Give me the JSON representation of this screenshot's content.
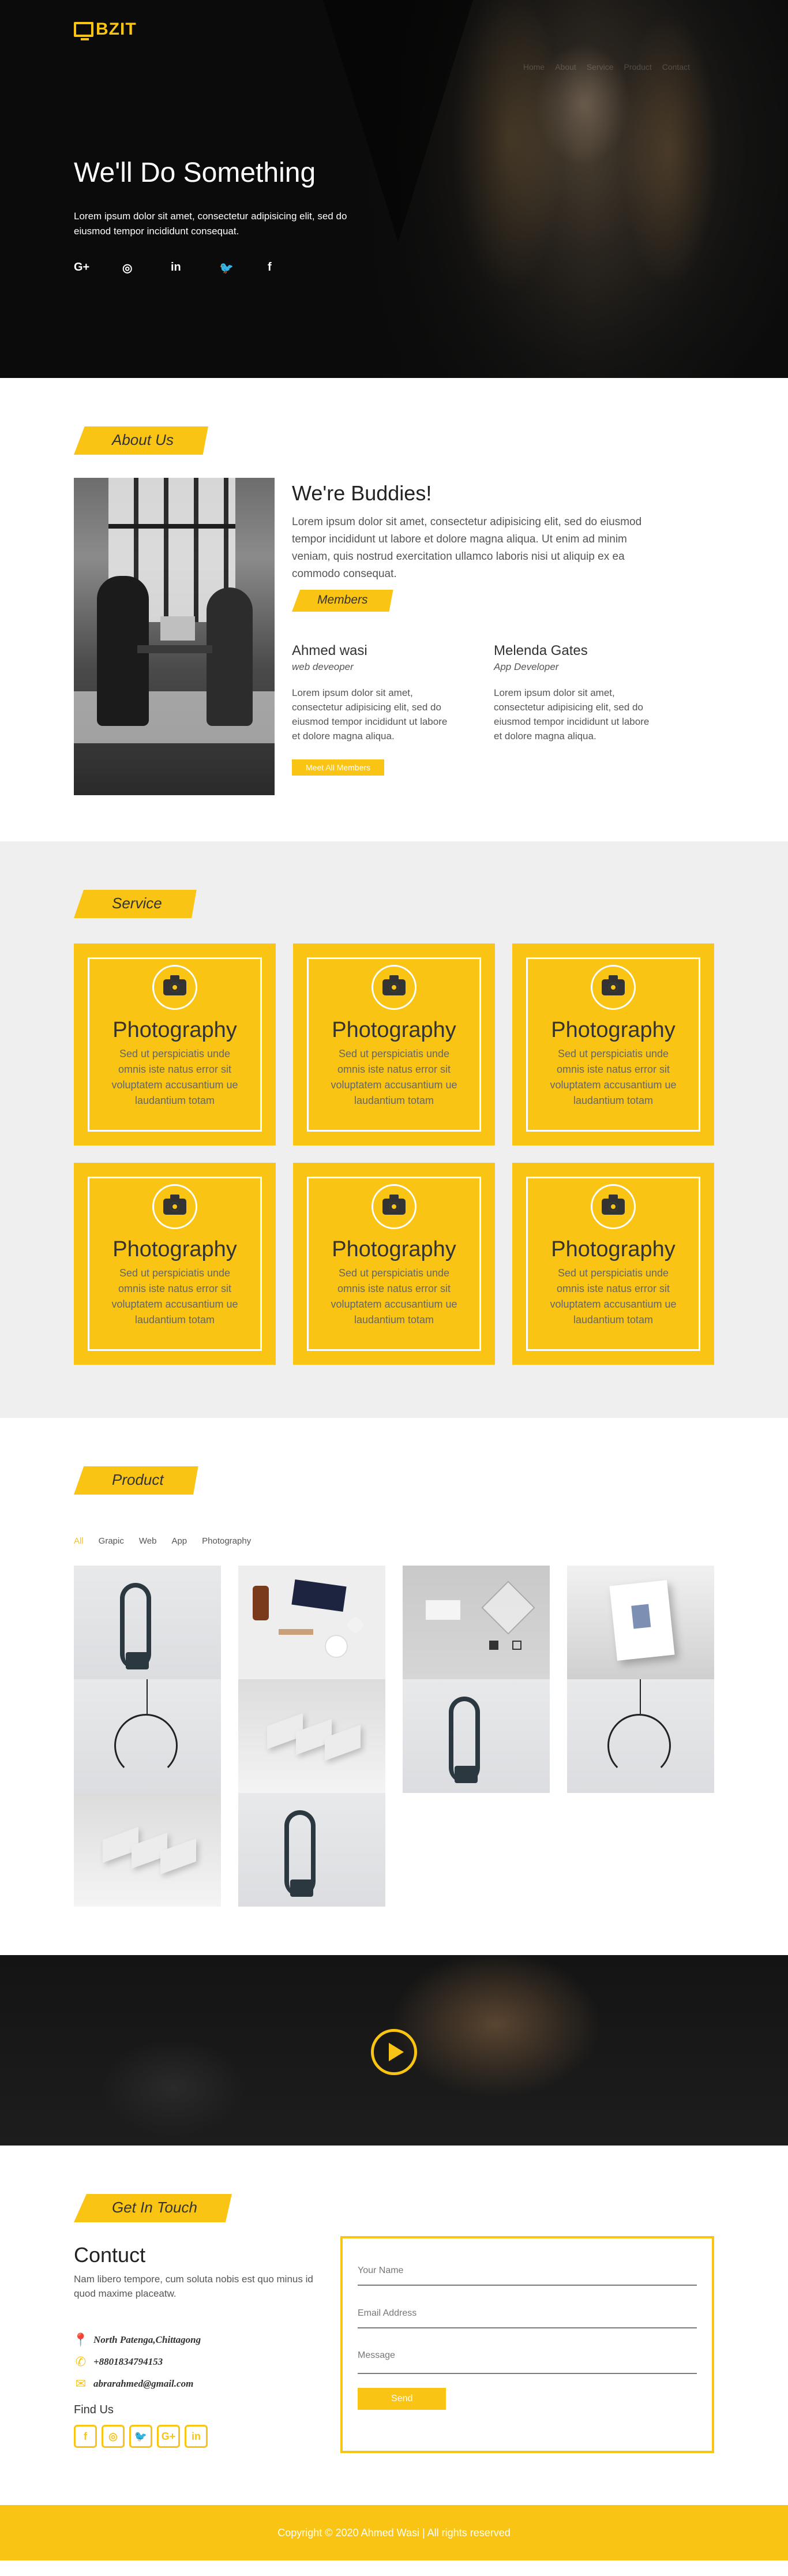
{
  "header": {
    "logo_text": "BZIT",
    "nav": [
      "Home",
      "About",
      "Service",
      "Product",
      "Contact"
    ],
    "title": "We'll Do Something",
    "text": "Lorem ipsum dolor sit amet, consectetur adipisicing elit, sed do eiusmod tempor incididunt consequat.",
    "socials": [
      "G+",
      "◎",
      "in",
      "🐦",
      "f"
    ]
  },
  "about": {
    "tag": "About Us",
    "heading": "We're Buddies!",
    "lead": "Lorem ipsum dolor sit amet, consectetur adipisicing elit, sed do eiusmod tempor incididunt ut labore et dolore magna aliqua. Ut enim ad minim veniam, quis nostrud exercitation ullamco laboris nisi ut aliquip ex ea commodo consequat.",
    "members_tag": "Members",
    "members": [
      {
        "name": "Ahmed wasi",
        "role": "web deveoper",
        "bio": "Lorem ipsum dolor sit amet, consectetur adipisicing elit, sed do eiusmod tempor incididunt ut labore et dolore magna aliqua."
      },
      {
        "name": "Melenda Gates",
        "role": "App Developer",
        "bio": "Lorem ipsum dolor sit amet, consectetur adipisicing elit, sed do eiusmod tempor incididunt ut labore et dolore magna aliqua."
      }
    ],
    "more_button": "Meet All Members"
  },
  "service": {
    "tag": "Service",
    "items": [
      {
        "title": "Photography",
        "text": "Sed ut perspiciatis unde omnis iste natus error sit voluptatem accusantium ue laudantium totam",
        "icon": "camera-icon"
      },
      {
        "title": "Photography",
        "text": "Sed ut perspiciatis unde omnis iste natus error sit voluptatem accusantium ue laudantium totam",
        "icon": "camera-icon"
      },
      {
        "title": "Photography",
        "text": "Sed ut perspiciatis unde omnis iste natus error sit voluptatem accusantium ue laudantium totam",
        "icon": "camera-icon"
      },
      {
        "title": "Photography",
        "text": "Sed ut perspiciatis unde omnis iste natus error sit voluptatem accusantium ue laudantium totam",
        "icon": "camera-icon"
      },
      {
        "title": "Photography",
        "text": "Sed ut perspiciatis unde omnis iste natus error sit voluptatem accusantium ue laudantium totam",
        "icon": "camera-icon"
      },
      {
        "title": "Photography",
        "text": "Sed ut perspiciatis unde omnis iste natus error sit voluptatem accusantium ue laudantium totam",
        "icon": "camera-icon"
      }
    ]
  },
  "product": {
    "tag": "Product",
    "filters": [
      "All",
      "Grapic",
      "Web",
      "App",
      "Photography"
    ],
    "active_filter": "All"
  },
  "video": {
    "icon": "play-icon"
  },
  "contact": {
    "tag": "Get In Touch",
    "heading": "Contuct",
    "desc": "Nam libero tempore, cum soluta nobis est quo minus id quod maxime placeatw.",
    "address": "North Patenga,Chittagong",
    "phone": "+8801834794153",
    "email": "abrarahmed@gmail.com",
    "find_label": "Find Us",
    "find_icons": [
      "f",
      "◎",
      "🐦",
      "G+",
      "in"
    ],
    "form": {
      "name_placeholder": "Your Name",
      "email_placeholder": "Email Address",
      "message_placeholder": "Message",
      "send_label": "Send"
    }
  },
  "footer": {
    "text": "Copyright © 2020 Ahmed Wasi | All rights reserved"
  },
  "colors": {
    "accent": "#f9c413",
    "dark": "#0b0b0b",
    "light_grey": "#efefef"
  }
}
